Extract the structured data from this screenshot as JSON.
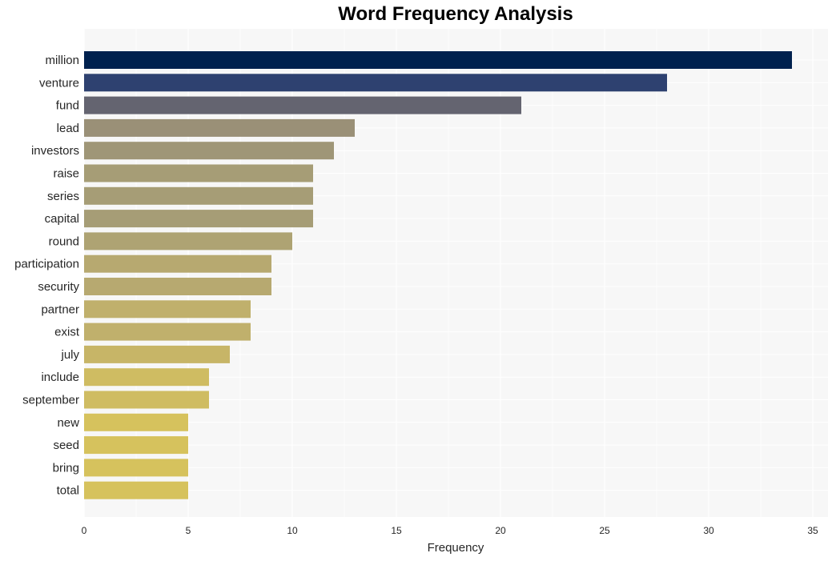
{
  "chart_data": {
    "type": "bar",
    "orientation": "horizontal",
    "title": "Word Frequency Analysis",
    "xlabel": "Frequency",
    "ylabel": "",
    "xlim": [
      0,
      35.7
    ],
    "xticks": [
      0,
      5,
      10,
      15,
      20,
      25,
      30,
      35
    ],
    "grid": true,
    "categories": [
      "million",
      "venture",
      "fund",
      "lead",
      "investors",
      "raise",
      "series",
      "capital",
      "round",
      "participation",
      "security",
      "partner",
      "exist",
      "july",
      "include",
      "september",
      "new",
      "seed",
      "bring",
      "total"
    ],
    "values": [
      34,
      28,
      21,
      13,
      12,
      11,
      11,
      11,
      10,
      9,
      9,
      8,
      8,
      7,
      6,
      6,
      5,
      5,
      5,
      5
    ],
    "colors": [
      "#00214e",
      "#2e4170",
      "#646470",
      "#9a9077",
      "#9f9677",
      "#a69d76",
      "#a69d76",
      "#a69d76",
      "#aea373",
      "#b7a970",
      "#b7a970",
      "#c0b06c",
      "#c0b06c",
      "#c7b567",
      "#cfbc62",
      "#cfbc62",
      "#d6c25d",
      "#d6c25d",
      "#d6c25d",
      "#d6c25d"
    ],
    "background_color": "#f7f7f7",
    "grid_color": "#ffffff"
  }
}
